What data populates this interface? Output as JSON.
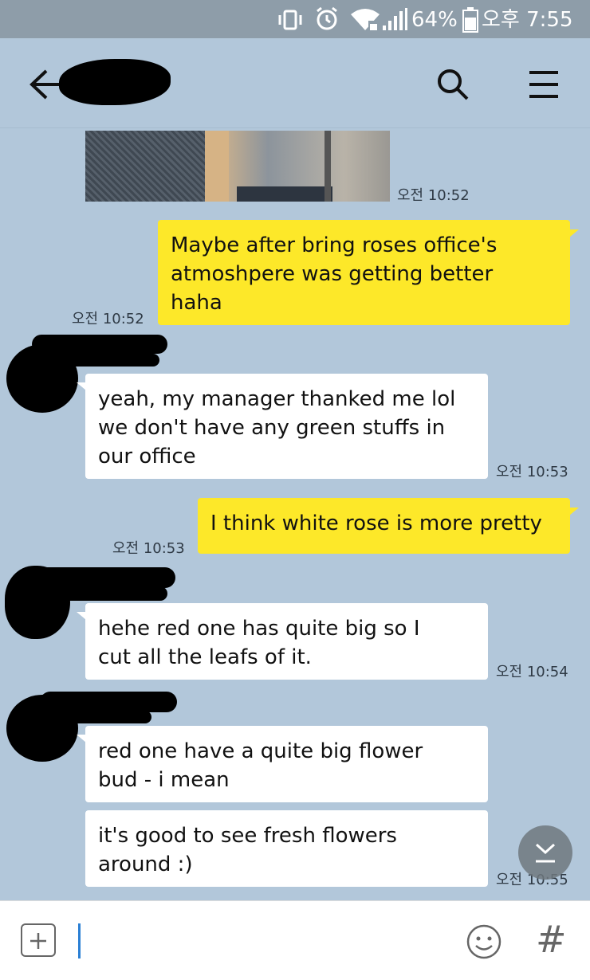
{
  "status_bar": {
    "battery": "64%",
    "time": "오후 7:55",
    "icons": [
      "vibrate-icon",
      "alarm-icon",
      "wifi-icon",
      "signal-icon",
      "battery-icon"
    ]
  },
  "header": {
    "back_icon": "back-arrow-icon",
    "search_icon": "search-icon",
    "menu_icon": "menu-icon"
  },
  "messages": [
    {
      "type": "photo",
      "sender": "other",
      "time": "오전 10:52"
    },
    {
      "sender": "me",
      "lines": [
        "Maybe after bring roses office's",
        "atmoshpere was getting better",
        "haha"
      ],
      "time": "오전 10:52"
    },
    {
      "sender": "other",
      "lines": [
        "yeah, my manager thanked me lol",
        "we don't have any green stuffs in",
        "our office"
      ],
      "time": "오전 10:53"
    },
    {
      "sender": "me",
      "lines": [
        "I think white rose is more pretty"
      ],
      "time": "오전 10:53"
    },
    {
      "sender": "other",
      "lines": [
        "hehe red one has quite big so I",
        "cut all the leafs of it."
      ],
      "time": "오전 10:54"
    },
    {
      "sender": "other",
      "lines": [
        "red one have a quite big flower",
        "bud - i mean"
      ]
    },
    {
      "sender": "other",
      "lines": [
        "it's good to see fresh flowers",
        "around :)"
      ],
      "time": "오전 10:55"
    }
  ],
  "input_bar": {
    "plus_icon": "plus-icon",
    "emoji_icon": "emoji-icon",
    "hash_icon": "hashtag-icon",
    "hash_label": "#"
  },
  "colors": {
    "chat_bg": "#b2c7da",
    "my_bubble": "#fde829",
    "their_bubble": "#ffffff",
    "status_bar": "#8e9da9"
  }
}
